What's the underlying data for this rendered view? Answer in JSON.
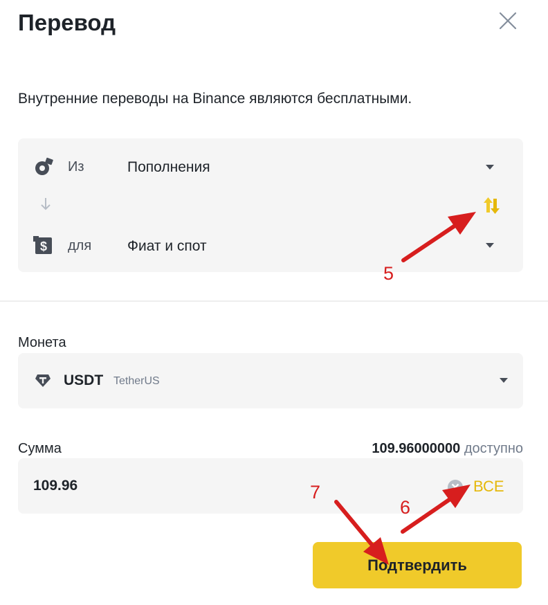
{
  "header": {
    "title": "Перевод",
    "close_icon": "close-icon"
  },
  "info": {
    "text": "Внутренние переводы на Binance являются бесплатными."
  },
  "transfer": {
    "from": {
      "label": "Из",
      "value": "Пополнения",
      "icon": "wallet-icon"
    },
    "to": {
      "label": "для",
      "value": "Фиат и спот",
      "icon": "dollar-wallet-icon"
    },
    "swap_icon": "swap-icon",
    "down_arrow_icon": "arrow-down-icon"
  },
  "coin": {
    "label": "Монета",
    "symbol": "USDT",
    "name": "TetherUS",
    "icon": "tether-icon"
  },
  "amount": {
    "label": "Сумма",
    "available_value": "109.96000000",
    "available_suffix": "доступно",
    "value": "109.96",
    "clear_icon": "clear-icon",
    "max_label": "ВСЕ"
  },
  "confirm_label": "Подтвердить",
  "annotations": [
    "5",
    "6",
    "7"
  ],
  "colors": {
    "accent": "#f0ca2a",
    "accent_text": "#e5b80b",
    "annotation": "#d71e1e",
    "field_bg": "#f5f5f5"
  }
}
